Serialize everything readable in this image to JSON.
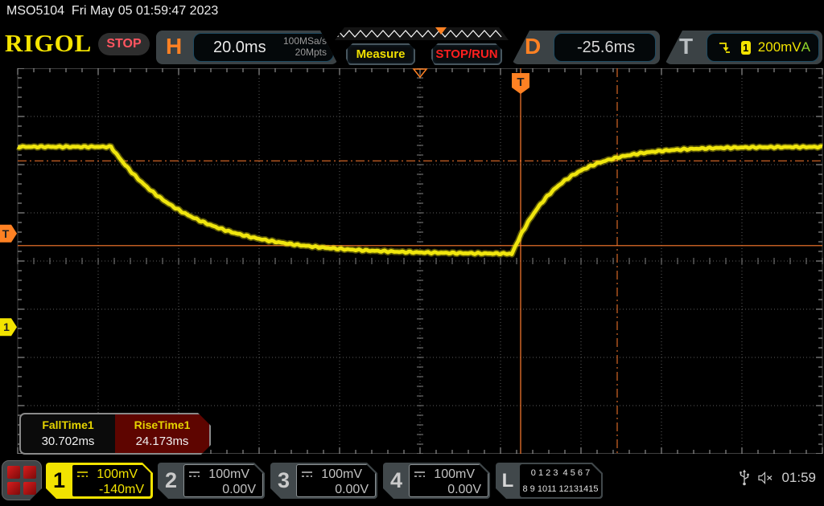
{
  "titlebar": {
    "text": "MSO5104  Fri May 05 01:59:47 2023"
  },
  "toolbar": {
    "logo": "RIGOL",
    "run_state": "STOP",
    "horizontal": {
      "label": "H",
      "scale": "20.0ms",
      "sample_rate": "100MSa/s",
      "mem_depth": "20Mpts"
    },
    "sweep": {
      "position_frac": 0.61
    },
    "measure_label": "Measure",
    "stoprun_label": "STOP/RUN",
    "delay": {
      "label": "D",
      "value": "-25.6ms"
    },
    "trigger": {
      "label": "T",
      "edge": "falling",
      "source_channel": "1",
      "level": "200mV",
      "mode": "A"
    }
  },
  "measurements": {
    "items": [
      {
        "name": "FallTime1",
        "value": "30.702ms",
        "selected": false
      },
      {
        "name": "RiseTime1",
        "value": "24.173ms",
        "selected": true
      }
    ]
  },
  "channels": [
    {
      "id": "1",
      "coupling": "DC",
      "scale": "100mV",
      "offset": "-140mV",
      "active": true
    },
    {
      "id": "2",
      "coupling": "DC",
      "scale": "100mV",
      "offset": "0.00V",
      "active": false
    },
    {
      "id": "3",
      "coupling": "DC",
      "scale": "100mV",
      "offset": "0.00V",
      "active": false
    },
    {
      "id": "4",
      "coupling": "DC",
      "scale": "100mV",
      "offset": "0.00V",
      "active": false
    }
  ],
  "digital": {
    "label": "L",
    "row1": "0 1 2 3  4 5 6 7",
    "row2": "8 9 1011 12131415"
  },
  "status": {
    "time": "01:59"
  },
  "colors": {
    "trace_yellow": "#f0e60e",
    "channel_yellow": "#f2e300",
    "accent_orange": "#ff8123",
    "stop_red": "#ff1f1f",
    "auto_green": "#8fd32a",
    "grid_dot": "#5c5c5c",
    "tick_gray": "#a8a8a8"
  },
  "chart_data": {
    "type": "line",
    "instrument": "oscilloscope",
    "title": "CH1 exponential fall/rise pulse",
    "h_divs": 10,
    "v_divs": 8,
    "timebase_per_div": "20.0ms",
    "ch1_scale_per_div": "100mV",
    "waveform_div": {
      "high_y": 1.63,
      "low_y": 3.86,
      "fall_start_x": 1.16,
      "fall_tau_x": 0.95,
      "rise_start_x": 6.14,
      "rise_tau_x": 0.57
    },
    "markers_div": {
      "center_marker_x": 5.0,
      "trigger_x": 6.25,
      "rise_end_x": 7.45,
      "upper_threshold_y": 1.92,
      "lower_threshold_y": 3.68,
      "trigger_level_marker_y": 3.43,
      "ch1_zero_y": 5.37
    }
  }
}
